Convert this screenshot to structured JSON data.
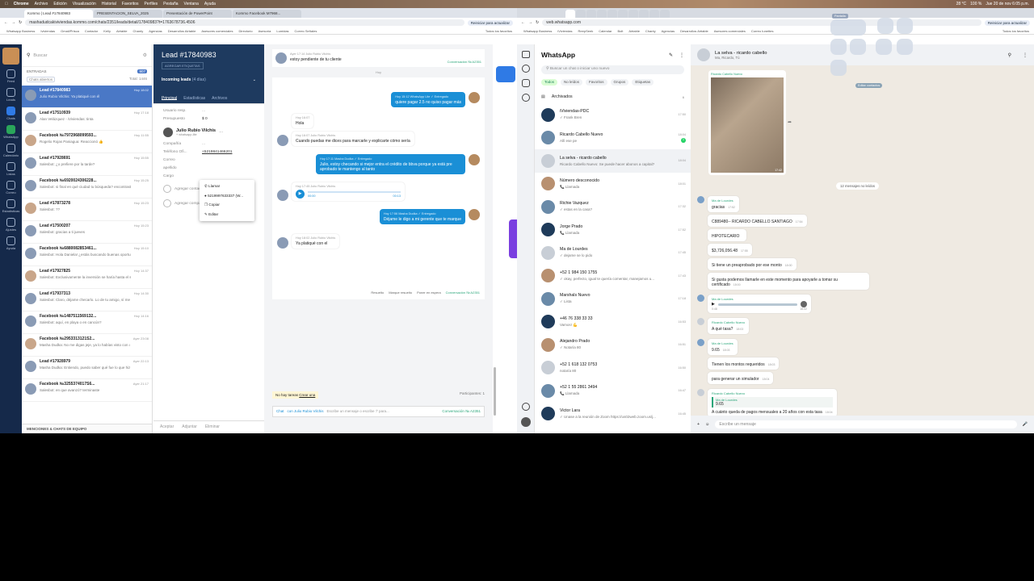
{
  "menubar": {
    "items": [
      "Chrome",
      "Archivo",
      "Edición",
      "Visualización",
      "Historial",
      "Favoritos",
      "Perfiles",
      "Pestaña",
      "Ventana",
      "Ayuda"
    ],
    "right": [
      "28 °C",
      "100 %",
      "Jue 20 de nov 6:05 p.m."
    ]
  },
  "left_browser": {
    "tabs": [
      "Kommo | Lead #17840983",
      "PRESENTACION_SELVA_2025",
      "Presentación de PowerPoint",
      "Kommo Facebook M7968..."
    ],
    "url": "mashadudcakiviviendas.kommo.com/chats/2351/leads/detail/17840983?t=1763678736.4506",
    "refresh_label": "Reiniciar para actualizar",
    "bookmarks": [
      "Whatsapp Business",
      "Iviviendas",
      "Gmail/Prisca",
      "Contador",
      "Kelly",
      "Airtable",
      "Chanty",
      "Agencias",
      "Desarrollos Airtable",
      "Asesores comerciales",
      "Directorio",
      "Asesoría",
      "Lumidas",
      "Correo Señales"
    ],
    "all_bookmarks": "Todos los favoritos"
  },
  "kommo": {
    "rail": [
      "Feed",
      "Leads",
      "Chats",
      "WhatsApp",
      "Calendario",
      "Listas",
      "Correo",
      "Estadísticas",
      "Ajustes",
      "Ayuda"
    ],
    "search_placeholder": "Buscar",
    "section": "ENTRADAS",
    "section_count": "907",
    "filter": "Chats abiertos",
    "filter_total": "Total: 1446",
    "items": [
      {
        "name": "Lead #17840983",
        "msg": "Julio Rubio Vilchis: Ya platiqué con él",
        "time": "Hoy 18:02"
      },
      {
        "name": "Lead #17510939",
        "msg": "Alan Velázquez - iViviendas: tinta",
        "time": "Hoy 17:18"
      },
      {
        "name": "Facebook №7972968099593...",
        "msg": "Rogelio Rojas Paniagua: Reaccionó 👍",
        "time": "Hoy 11:55"
      },
      {
        "name": "Lead #17928691",
        "msg": "Salesbot: ¿o prefiere por la tarde?",
        "time": "Hoy 15:55"
      },
      {
        "name": "Facebook №6920024306228...",
        "msg": "Salesbot: si final en qué ciudad tu búsqueda? encontraste algo?",
        "time": "Hoy 15:25"
      },
      {
        "name": "Lead #17873278",
        "msg": "Salesbot: ??",
        "time": "Hoy 15:23"
      },
      {
        "name": "Lead #17500207",
        "msg": "Salesbot: gracias a ti jueves",
        "time": "Hoy 15:23"
      },
      {
        "name": "Facebook №6880082853461...",
        "msg": "Salesbot: Hola Daniela! ¿estás buscando buenas oportunidades de inversión",
        "time": "Hoy 15:10"
      },
      {
        "name": "Lead #17927825",
        "msg": "Salesbot: Exclusivamente la inversión se haría hasta el siguiente año? o si hay un",
        "time": "Hoy 14:37"
      },
      {
        "name": "Lead #17937313",
        "msg": "Salesbot: Claro, déjame checarlo. Lo de tu amigo, sí me puedes mandar un WhatsApp",
        "time": "Hoy 14:30"
      },
      {
        "name": "Facebook №1487511569132...",
        "msg": "Salesbot: aquí, en playa o en cancún?",
        "time": "Hoy 14:16"
      },
      {
        "name": "Facebook №2953313121S2...",
        "msg": "Masha Dudka: No me digas jeje, ya lo habías visto con otro asesor? El tu vida",
        "time": "Ayer 23:08"
      },
      {
        "name": "Lead #17928979",
        "msg": "Masha Dudka: Entiendo, puedo saber qué fue lo que hizo que cambiaras de",
        "time": "Ayer 22:13"
      },
      {
        "name": "Facebook №3255374017S6...",
        "msg": "Salesbot: en que avanzó? terminaste",
        "time": "Ayer 21:17"
      }
    ],
    "footer": "MENCIONES & CHATS DE EQUIPO",
    "lead": {
      "title": "Lead #17840983",
      "tag_button": "AGREGAR ETIQUETAS",
      "pipeline": "Incoming leads",
      "pipeline_days": "(4 días)",
      "tabs": [
        "Principal",
        "Estadísticas",
        "Archivos"
      ],
      "fields": [
        {
          "label": "Usuario resp.",
          "value": "..."
        },
        {
          "label": "Presupuesto",
          "value": "$ 0"
        }
      ],
      "contact_name": "Julio Rubio Vilchis",
      "contact_sub": "+ whatsapp-lite",
      "contact_fields": [
        {
          "label": "Compañía",
          "value": "..."
        },
        {
          "label": "Teléfono Ofi...",
          "value": "+5219841466201"
        },
        {
          "label": "Correo",
          "value": ""
        },
        {
          "label": "apellido",
          "value": ""
        },
        {
          "label": "Cargo",
          "value": ""
        }
      ],
      "menu": [
        "Llamar",
        "5219997633337 (W...",
        "Copiar",
        "Editar"
      ],
      "add_contact": "Agregar contacto",
      "add_company": "Agregar compañía",
      "footer": [
        "Aceptar",
        "Adjuntar",
        "Eliminar"
      ]
    },
    "chat": {
      "messages": [
        {
          "dir": "in",
          "meta": "Ayer 17:14 Julio Rubio Vilchis",
          "text": "estoy pendiente de tu cliente",
          "tag": "Conversación № A2351"
        },
        {
          "dir": "out",
          "meta": "Hoy 15:12 WhatsApp Lite ✓ Entregado",
          "text": "quiere pagar 2.5 no quiso pagar más"
        },
        {
          "dir": "in",
          "meta": "Hoy 16:07",
          "text": "Hola"
        },
        {
          "dir": "in",
          "meta": "Hoy 16:07 Julio Rubio Vilchis",
          "text": "Cuando puedas me dices para marcarle y explicarte cómo sería"
        },
        {
          "dir": "out",
          "meta": "Hoy 17:11 Masha Dudka ✓ Entregado",
          "text": "Julio, estoy checando si mejor entra el crédito de bbva porque ya está pre aprobado te mantengo al tanto"
        },
        {
          "dir": "in",
          "meta": "Hoy 17:45 Julio Rubio Vilchis",
          "text": "00:00",
          "audio": "00:13"
        },
        {
          "dir": "out",
          "meta": "Hoy 17:56 Masha Dudka ✓ Entregado",
          "text": "Déjame le digo a mi gerente que te marque"
        },
        {
          "dir": "in",
          "meta": "Hoy 18:02 Julio Rubio Vilchis",
          "text": "Ya platiqué con el"
        }
      ],
      "day": "Hoy",
      "actions": [
        "Resuelto",
        "Marque resuelto",
        "Poner en espera"
      ],
      "conv": "Conversación № A2351",
      "no_tasks": "No hay tareas",
      "create": "Crear una",
      "participants": "Participantes: 1",
      "composer_to": "Chat",
      "composer_with": "con Julio Rubio Vilchis",
      "composer_placeholder": "Escribe un mensaje o escribe '/' para...",
      "composer_conv": "Conversación № A2351"
    }
  },
  "right_browser": {
    "url": "web.whatsapp.com",
    "refresh_label": "Reiniciar para actualizar",
    "bookmarks": [
      "Whatsapp Business",
      "iViviendas",
      "ReepSeek",
      "Calendar",
      "Bolt",
      "Airtable",
      "Chanty",
      "Agencias",
      "Desarrollos Airtable",
      "Asesores comerciales",
      "Correo Iunettes"
    ],
    "all_bookmarks": "Todos los favoritos"
  },
  "whatsapp": {
    "title": "WhatsApp",
    "search_placeholder": "Buscar un chat o iniciar uno nuevo",
    "filters": [
      "Todos",
      "No leídos",
      "Favoritos",
      "Grupos",
      "Etiquetas"
    ],
    "archived": "Archivados",
    "archived_count": "6",
    "chats": [
      {
        "name": "iViviendas-PDC",
        "msg": "✓ Frank Bren",
        "time": "17:50"
      },
      {
        "name": "Ricardo Cabello Nuevo",
        "msg": "Allí ese pe",
        "time": "18:04",
        "unread": "1"
      },
      {
        "name": "La selva - ricardo cabello",
        "msg": "Ricardo Cabello Nuevo: Se puede hacer abonos a capital?",
        "time": "18:04"
      },
      {
        "name": "Número desconocido",
        "msg": "📞 Llamada",
        "time": "18:01"
      },
      {
        "name": "Richie Vazquez",
        "msg": "✓ estas en la casa?",
        "time": "17:32"
      },
      {
        "name": "Jorge Prado",
        "msg": "📞 Llamada",
        "time": "17:52"
      },
      {
        "name": "Ma de Lourdes",
        "msg": "✓ dejame se lo pido",
        "time": "17:45"
      },
      {
        "name": "+52 1 984 150 1755",
        "msg": "✓ okay, perfecto, igual te quería comentar, manejamos u...",
        "time": "17:43"
      },
      {
        "name": "Marshals Nuevo",
        "msg": "✓ Lista",
        "time": "17:18"
      },
      {
        "name": "+46 76 338 33 33",
        "msg": "Vamos! 💪",
        "time": "16:53"
      },
      {
        "name": "Alejandro Prado",
        "msg": "✓ Notaría 80",
        "time": "16:51"
      },
      {
        "name": "+52 1 618 132 0753",
        "msg": "notaría 80",
        "time": "16:50"
      },
      {
        "name": "+52 1 55 2861 3494",
        "msg": "📞 Llamada",
        "time": "16:47"
      },
      {
        "name": "Victor Lara",
        "msg": "✓ Unase a la reunión de Zoom https://us02web.zoom.us/j...",
        "time": "16:45"
      }
    ],
    "conv": {
      "title": "La selva - ricardo cabello",
      "subtitle": "Ma, Ricardo, Tú",
      "unread_banner": "12 mensajes no leídos",
      "edit_contacts": "Editar contactos",
      "image_sender": "Ricardo Cabello Nuevo",
      "image_time": "17:42",
      "messages": [
        {
          "sender": "Ma de Lourdes",
          "lines": [
            {
              "t": "gracias",
              "time": "17:52"
            },
            {
              "t": "C889480-- RICARDO CABELLO SANTIAGO",
              "time": "17:54"
            },
            {
              "t": "HIPOTECARIO",
              "time": ""
            },
            {
              "t": "$3,726,056.48",
              "time": "17:55"
            },
            {
              "t": "Si tiene un preaprobado por ese monto",
              "time": "18:00"
            },
            {
              "t": "Si gusta podemos llamarle en este momento para apoyarle a tomar su certificado",
              "time": "18:00"
            }
          ]
        },
        {
          "sender": "Ma de Lourdes",
          "audio_time": "0:48",
          "time": "18:02"
        },
        {
          "sender": "Ricardo Cabello Nuevo",
          "lines": [
            {
              "t": "A qué tasa?",
              "time": "18:03"
            }
          ]
        },
        {
          "sender": "Ma de Lourdes",
          "lines": [
            {
              "t": "9.65",
              "time": "18:03"
            },
            {
              "t": "Tienen los montos requeridos",
              "time": "18:03"
            },
            {
              "t": "para generar un simulador",
              "time": "18:04"
            }
          ]
        },
        {
          "sender": "Ricardo Cabello Nuevo",
          "quote_name": "Ma de Lourdes",
          "quote": "9.65",
          "lines": [
            {
              "t": "A cuánto queda de pagos mensuales a 20 años con esta tasa",
              "time": "18:04"
            },
            {
              "t": "Se puede hacer abonos a capital?",
              "time": "18:04"
            }
          ]
        }
      ],
      "composer_placeholder": "Escribe un mensaje"
    }
  },
  "overlay": {
    "label": "Pantalla"
  }
}
